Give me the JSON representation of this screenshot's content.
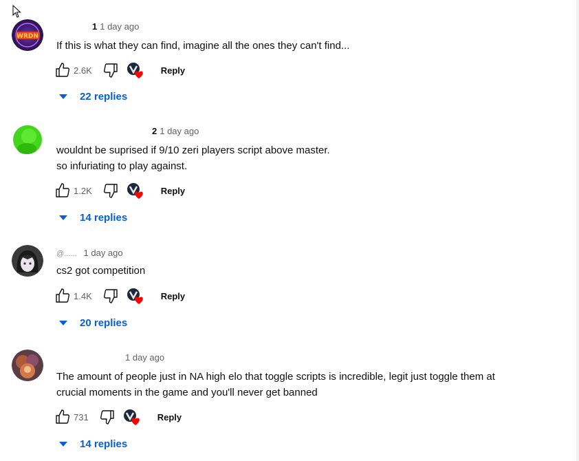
{
  "accent_color": "#065fd4",
  "comments": [
    {
      "handle": "1",
      "time": "1 day ago",
      "lines": [
        "If this is what they can find, imagine all the ones they can't find..."
      ],
      "likes": "2.6K",
      "reply_label": "Reply",
      "replies_label": "22 replies",
      "avatar_icon": "purple-logo-avatar"
    },
    {
      "handle": "2",
      "time": "1 day ago",
      "lines": [
        "wouldnt be suprised if 9/10 zeri players script above master.",
        "so infuriating to play against."
      ],
      "likes": "1.2K",
      "reply_label": "Reply",
      "replies_label": "14 replies",
      "avatar_icon": "green-face-avatar"
    },
    {
      "handle": "@......",
      "time": "1 day ago",
      "lines": [
        "cs2 got competition"
      ],
      "likes": "1.4K",
      "reply_label": "Reply",
      "replies_label": "20 replies",
      "avatar_icon": "anime-girl-avatar"
    },
    {
      "handle": "",
      "time": "1 day ago",
      "lines": [
        "The amount of people just in NA high elo that toggle scripts is incredible, legit just toggle them at",
        "crucial moments in the game and you'll never get banned"
      ],
      "likes": "731",
      "reply_label": "Reply",
      "replies_label": "14 replies",
      "avatar_icon": "champion-art-avatar"
    }
  ]
}
